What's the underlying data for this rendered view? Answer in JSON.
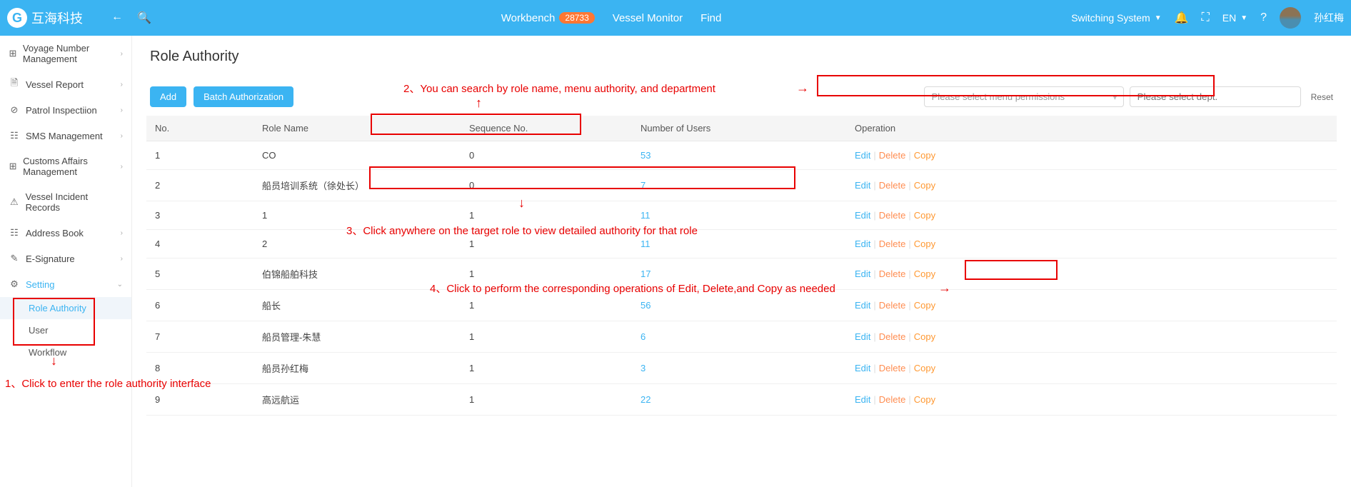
{
  "header": {
    "brand": "互海科技",
    "nav": {
      "workbench": "Workbench",
      "workbench_badge": "28733",
      "vessel_monitor": "Vessel Monitor",
      "find": "Find"
    },
    "right": {
      "switching": "Switching System",
      "lang": "EN",
      "username": "孙红梅"
    }
  },
  "sidebar": {
    "items": [
      {
        "label": "Voyage Number Management",
        "expandable": true
      },
      {
        "label": "Vessel Report",
        "expandable": true
      },
      {
        "label": "Patrol Inspectiion",
        "expandable": true
      },
      {
        "label": "SMS Management",
        "expandable": true
      },
      {
        "label": "Customs Affairs Management",
        "expandable": true
      },
      {
        "label": "Vessel Incident Records",
        "expandable": false
      },
      {
        "label": "Address Book",
        "expandable": true
      },
      {
        "label": "E-Signature",
        "expandable": true
      },
      {
        "label": "Setting",
        "expandable": true,
        "active": true
      }
    ],
    "subs": [
      {
        "label": "Role Authority",
        "active": true
      },
      {
        "label": "User"
      },
      {
        "label": "Workflow"
      }
    ]
  },
  "page": {
    "title": "Role Authority"
  },
  "toolbar": {
    "add": "Add",
    "batch": "Batch Authorization",
    "menu_placeholder": "Please select menu permissions",
    "dept_placeholder": "Please select dept.",
    "reset": "Reset"
  },
  "table": {
    "headers": {
      "no": "No.",
      "role": "Role Name",
      "seq": "Sequence No.",
      "users": "Number of Users",
      "op": "Operation"
    },
    "ops": {
      "edit": "Edit",
      "delete": "Delete",
      "copy": "Copy"
    },
    "rows": [
      {
        "no": "1",
        "role": "CO",
        "seq": "0",
        "users": "53"
      },
      {
        "no": "2",
        "role": "船员培训系统（徐处长）",
        "seq": "0",
        "users": "7"
      },
      {
        "no": "3",
        "role": "1",
        "seq": "1",
        "users": "11"
      },
      {
        "no": "4",
        "role": "2",
        "seq": "1",
        "users": "11"
      },
      {
        "no": "5",
        "role": "伯锦船舶科技",
        "seq": "1",
        "users": "17"
      },
      {
        "no": "6",
        "role": "船长",
        "seq": "1",
        "users": "56"
      },
      {
        "no": "7",
        "role": "船员管理-朱慧",
        "seq": "1",
        "users": "6"
      },
      {
        "no": "8",
        "role": "船员孙红梅",
        "seq": "1",
        "users": "3"
      },
      {
        "no": "9",
        "role": "高远航运",
        "seq": "1",
        "users": "22"
      }
    ]
  },
  "annotations": {
    "a1": "1、Click to enter the role authority interface",
    "a2": "2、You can search by role name, menu authority, and department",
    "a3": "3、Click anywhere on the target role to view detailed authority for that role",
    "a4": "4、Click to perform the corresponding operations of Edit, Delete,and Copy as needed"
  }
}
